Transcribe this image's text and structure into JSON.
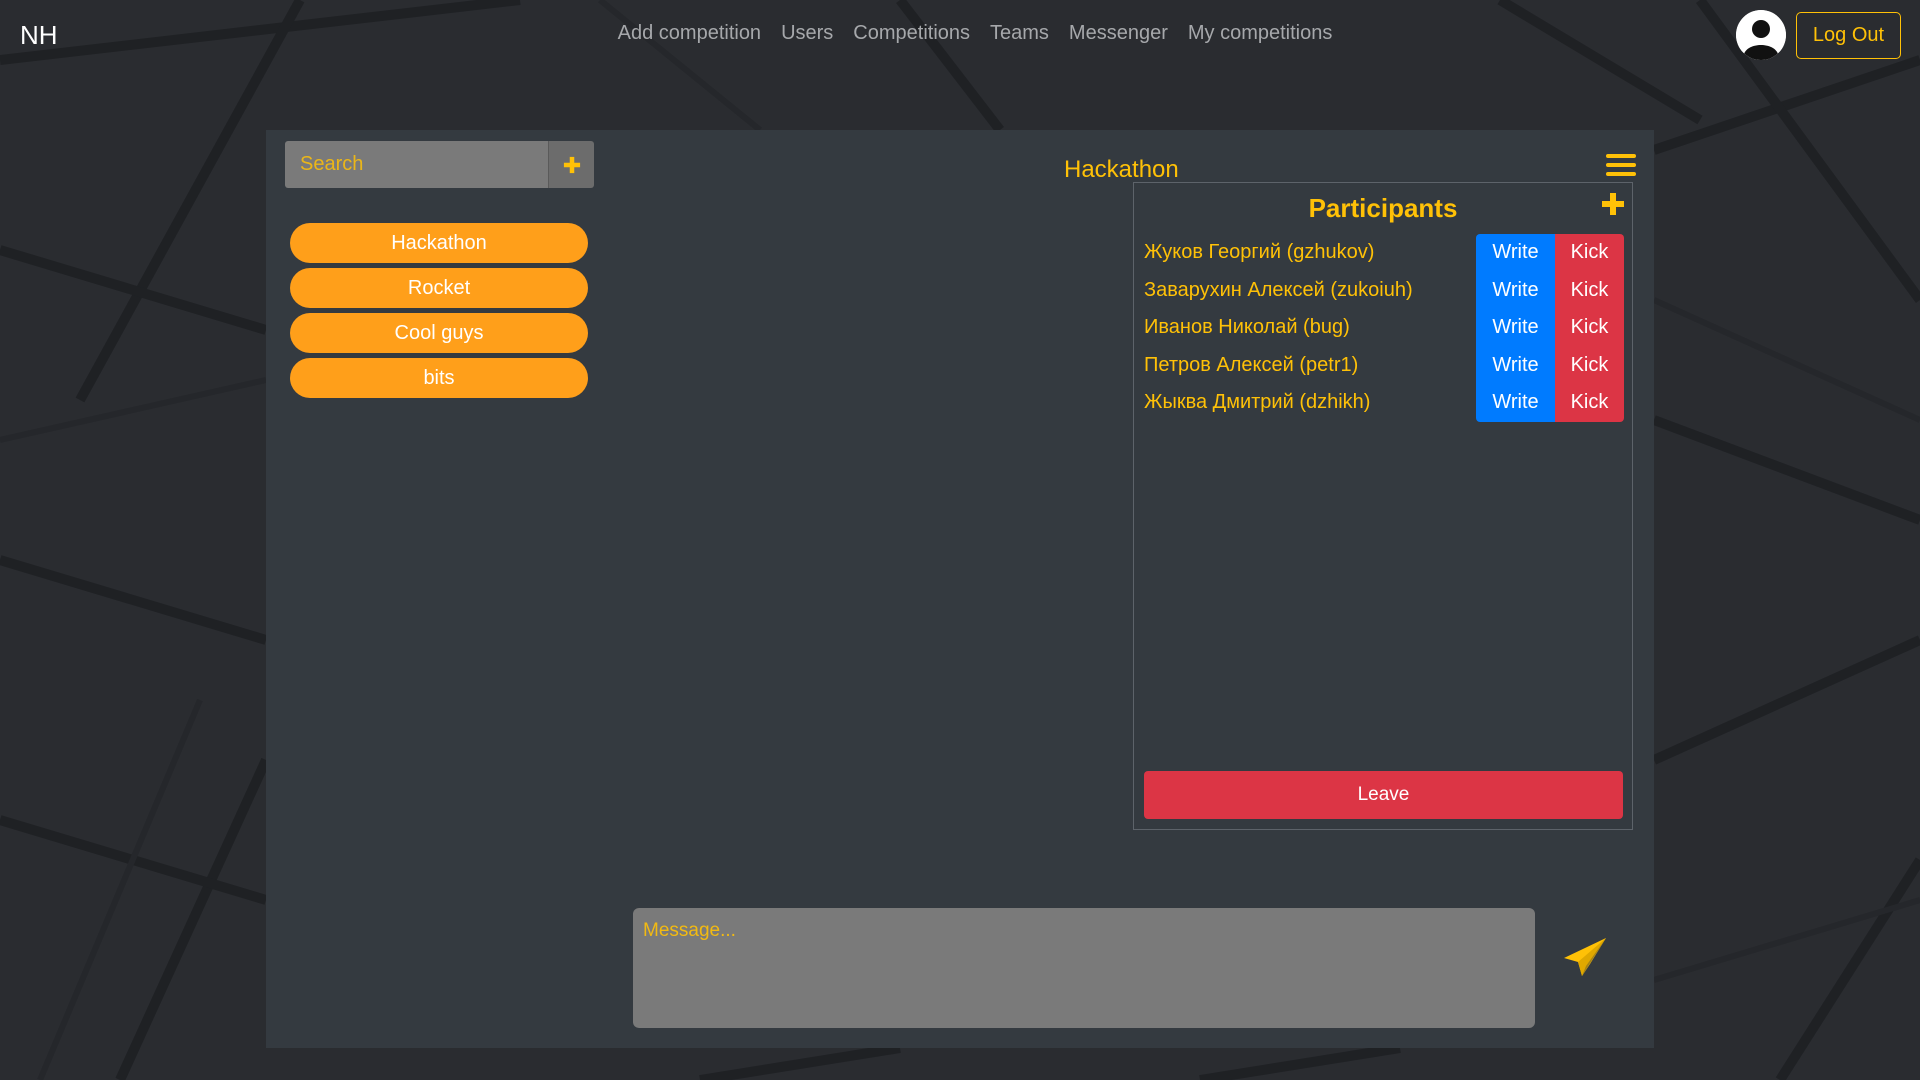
{
  "navbar": {
    "brand": "NH",
    "links": [
      "Add competition",
      "Users",
      "Competitions",
      "Teams",
      "Messenger",
      "My competitions"
    ],
    "logout_label": "Log Out"
  },
  "sidebar": {
    "search_placeholder": "Search",
    "chats": [
      "Hackathon",
      "Rocket",
      "Cool guys",
      "bits"
    ]
  },
  "chat": {
    "title": "Hackathon",
    "message_placeholder": "Message..."
  },
  "participants": {
    "heading": "Participants",
    "write_label": "Write",
    "kick_label": "Kick",
    "members": [
      "Жуков Георгий (gzhukov)",
      "Заварухин Алексей (zukoiuh)",
      "Иванов Николай (bug)",
      "Петров Алексей (petr1)",
      "Жыква Дмитрий (dzhikh)"
    ],
    "leave_label": "Leave"
  },
  "colors": {
    "accent": "#ffc107",
    "pill": "#ff9f1a",
    "panel": "#343a40",
    "write": "#007bff",
    "kick": "#dc3545"
  },
  "icons": {
    "add": "plus-icon",
    "menu": "hamburger-icon",
    "send": "paper-plane-icon",
    "avatar": "user-avatar-icon"
  }
}
